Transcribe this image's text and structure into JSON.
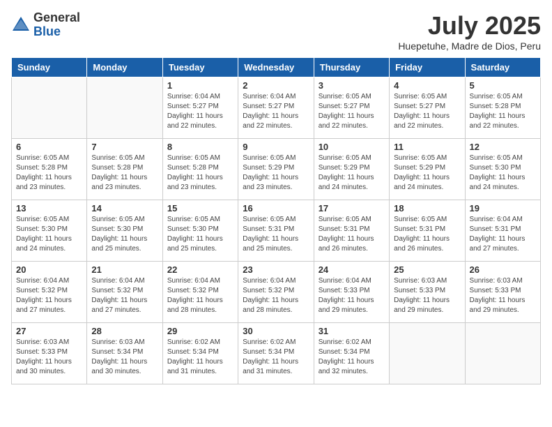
{
  "header": {
    "logo_general": "General",
    "logo_blue": "Blue",
    "month": "July 2025",
    "location": "Huepetuhe, Madre de Dios, Peru"
  },
  "weekdays": [
    "Sunday",
    "Monday",
    "Tuesday",
    "Wednesday",
    "Thursday",
    "Friday",
    "Saturday"
  ],
  "weeks": [
    [
      {
        "day": "",
        "info": ""
      },
      {
        "day": "",
        "info": ""
      },
      {
        "day": "1",
        "info": "Sunrise: 6:04 AM\nSunset: 5:27 PM\nDaylight: 11 hours\nand 22 minutes."
      },
      {
        "day": "2",
        "info": "Sunrise: 6:04 AM\nSunset: 5:27 PM\nDaylight: 11 hours\nand 22 minutes."
      },
      {
        "day": "3",
        "info": "Sunrise: 6:05 AM\nSunset: 5:27 PM\nDaylight: 11 hours\nand 22 minutes."
      },
      {
        "day": "4",
        "info": "Sunrise: 6:05 AM\nSunset: 5:27 PM\nDaylight: 11 hours\nand 22 minutes."
      },
      {
        "day": "5",
        "info": "Sunrise: 6:05 AM\nSunset: 5:28 PM\nDaylight: 11 hours\nand 22 minutes."
      }
    ],
    [
      {
        "day": "6",
        "info": "Sunrise: 6:05 AM\nSunset: 5:28 PM\nDaylight: 11 hours\nand 23 minutes."
      },
      {
        "day": "7",
        "info": "Sunrise: 6:05 AM\nSunset: 5:28 PM\nDaylight: 11 hours\nand 23 minutes."
      },
      {
        "day": "8",
        "info": "Sunrise: 6:05 AM\nSunset: 5:28 PM\nDaylight: 11 hours\nand 23 minutes."
      },
      {
        "day": "9",
        "info": "Sunrise: 6:05 AM\nSunset: 5:29 PM\nDaylight: 11 hours\nand 23 minutes."
      },
      {
        "day": "10",
        "info": "Sunrise: 6:05 AM\nSunset: 5:29 PM\nDaylight: 11 hours\nand 24 minutes."
      },
      {
        "day": "11",
        "info": "Sunrise: 6:05 AM\nSunset: 5:29 PM\nDaylight: 11 hours\nand 24 minutes."
      },
      {
        "day": "12",
        "info": "Sunrise: 6:05 AM\nSunset: 5:30 PM\nDaylight: 11 hours\nand 24 minutes."
      }
    ],
    [
      {
        "day": "13",
        "info": "Sunrise: 6:05 AM\nSunset: 5:30 PM\nDaylight: 11 hours\nand 24 minutes."
      },
      {
        "day": "14",
        "info": "Sunrise: 6:05 AM\nSunset: 5:30 PM\nDaylight: 11 hours\nand 25 minutes."
      },
      {
        "day": "15",
        "info": "Sunrise: 6:05 AM\nSunset: 5:30 PM\nDaylight: 11 hours\nand 25 minutes."
      },
      {
        "day": "16",
        "info": "Sunrise: 6:05 AM\nSunset: 5:31 PM\nDaylight: 11 hours\nand 25 minutes."
      },
      {
        "day": "17",
        "info": "Sunrise: 6:05 AM\nSunset: 5:31 PM\nDaylight: 11 hours\nand 26 minutes."
      },
      {
        "day": "18",
        "info": "Sunrise: 6:05 AM\nSunset: 5:31 PM\nDaylight: 11 hours\nand 26 minutes."
      },
      {
        "day": "19",
        "info": "Sunrise: 6:04 AM\nSunset: 5:31 PM\nDaylight: 11 hours\nand 27 minutes."
      }
    ],
    [
      {
        "day": "20",
        "info": "Sunrise: 6:04 AM\nSunset: 5:32 PM\nDaylight: 11 hours\nand 27 minutes."
      },
      {
        "day": "21",
        "info": "Sunrise: 6:04 AM\nSunset: 5:32 PM\nDaylight: 11 hours\nand 27 minutes."
      },
      {
        "day": "22",
        "info": "Sunrise: 6:04 AM\nSunset: 5:32 PM\nDaylight: 11 hours\nand 28 minutes."
      },
      {
        "day": "23",
        "info": "Sunrise: 6:04 AM\nSunset: 5:32 PM\nDaylight: 11 hours\nand 28 minutes."
      },
      {
        "day": "24",
        "info": "Sunrise: 6:04 AM\nSunset: 5:33 PM\nDaylight: 11 hours\nand 29 minutes."
      },
      {
        "day": "25",
        "info": "Sunrise: 6:03 AM\nSunset: 5:33 PM\nDaylight: 11 hours\nand 29 minutes."
      },
      {
        "day": "26",
        "info": "Sunrise: 6:03 AM\nSunset: 5:33 PM\nDaylight: 11 hours\nand 29 minutes."
      }
    ],
    [
      {
        "day": "27",
        "info": "Sunrise: 6:03 AM\nSunset: 5:33 PM\nDaylight: 11 hours\nand 30 minutes."
      },
      {
        "day": "28",
        "info": "Sunrise: 6:03 AM\nSunset: 5:34 PM\nDaylight: 11 hours\nand 30 minutes."
      },
      {
        "day": "29",
        "info": "Sunrise: 6:02 AM\nSunset: 5:34 PM\nDaylight: 11 hours\nand 31 minutes."
      },
      {
        "day": "30",
        "info": "Sunrise: 6:02 AM\nSunset: 5:34 PM\nDaylight: 11 hours\nand 31 minutes."
      },
      {
        "day": "31",
        "info": "Sunrise: 6:02 AM\nSunset: 5:34 PM\nDaylight: 11 hours\nand 32 minutes."
      },
      {
        "day": "",
        "info": ""
      },
      {
        "day": "",
        "info": ""
      }
    ]
  ]
}
